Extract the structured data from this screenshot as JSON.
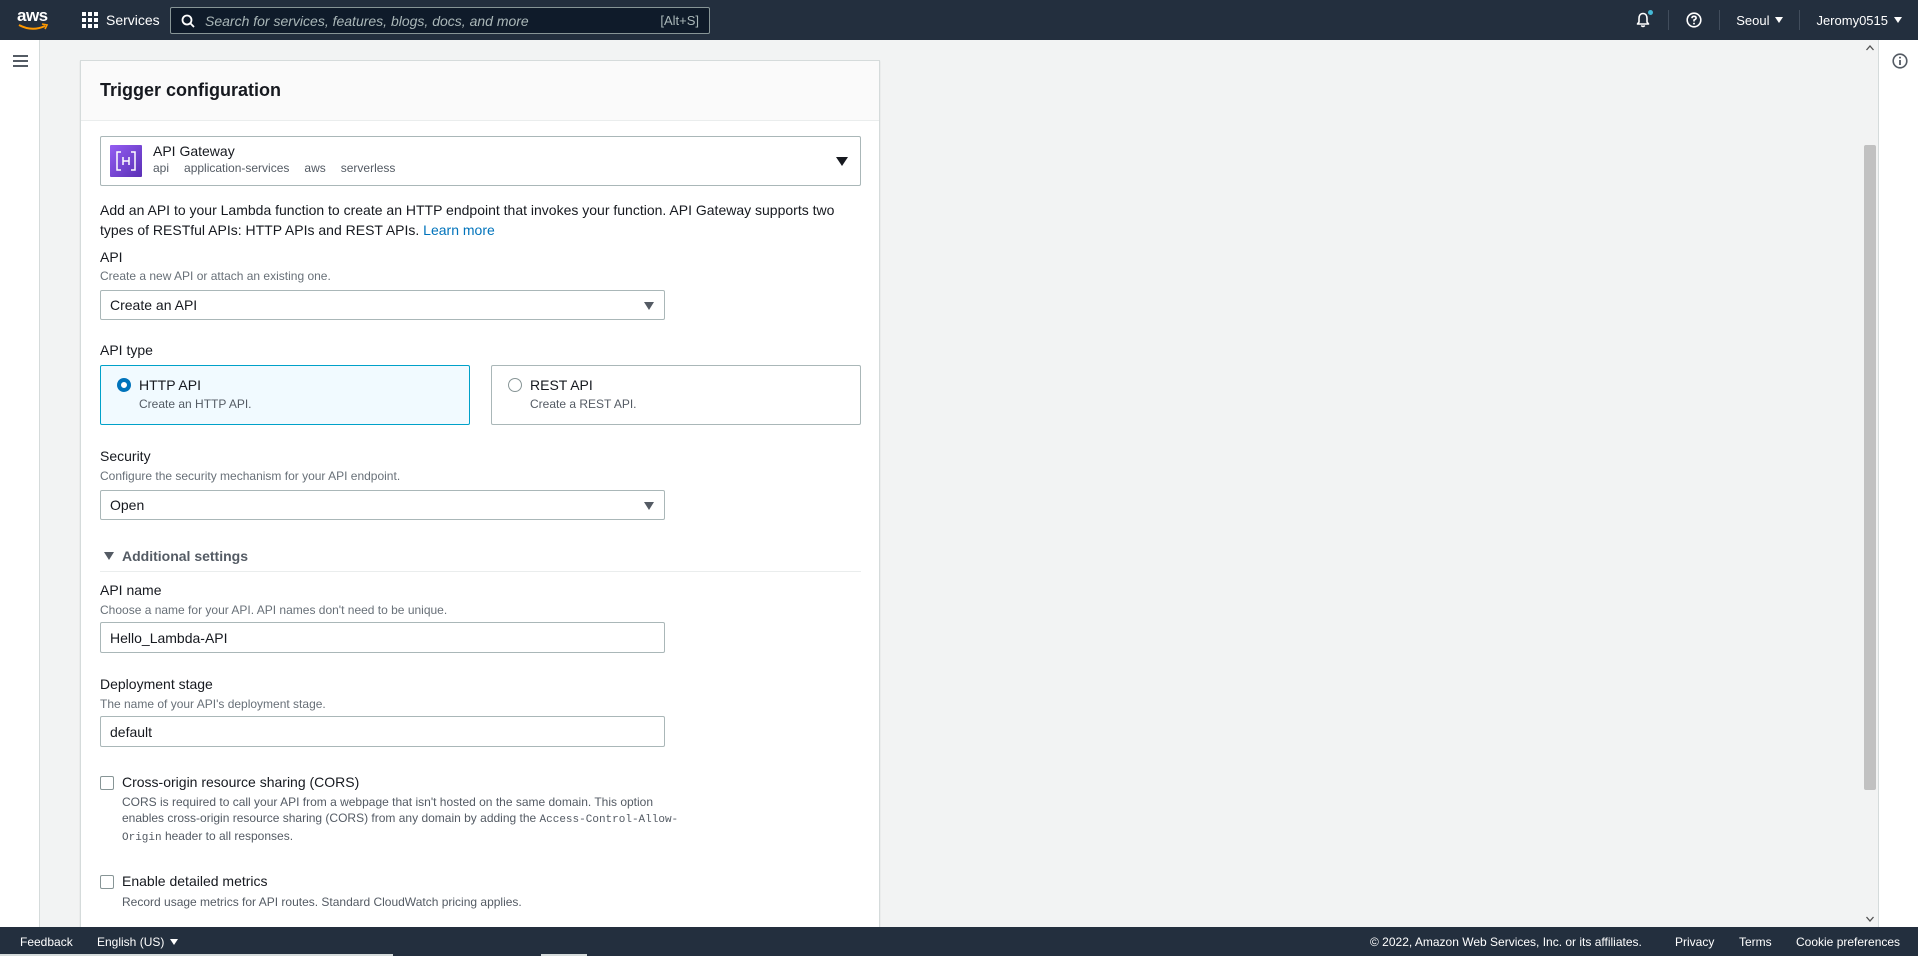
{
  "topnav": {
    "logo_text": "aws",
    "services_label": "Services",
    "search_placeholder": "Search for services, features, blogs, docs, and more",
    "search_shortcut": "[Alt+S]",
    "region": "Seoul",
    "user": "Jeromy0515",
    "notification_dot_color": "#44b9d6"
  },
  "icons": {
    "menu": "hamburger-icon",
    "info": "info-icon",
    "bell": "bell-icon",
    "help": "help-icon",
    "search": "search-icon",
    "grid": "grid-icon"
  },
  "panel": {
    "title": "Trigger configuration",
    "trigger": {
      "name": "API Gateway",
      "tags": [
        "api",
        "application-services",
        "aws",
        "serverless"
      ]
    },
    "description": "Add an API to your Lambda function to create an HTTP endpoint that invokes your function. API Gateway supports two types of RESTful APIs: HTTP APIs and REST APIs.",
    "learn_more": "Learn more",
    "api": {
      "label": "API",
      "sublabel": "Create a new API or attach an existing one.",
      "value": "Create an API"
    },
    "api_type": {
      "label": "API type",
      "options": [
        {
          "title": "HTTP API",
          "sub": "Create an HTTP API.",
          "selected": true
        },
        {
          "title": "REST API",
          "sub": "Create a REST API.",
          "selected": false
        }
      ]
    },
    "security": {
      "label": "Security",
      "sublabel": "Configure the security mechanism for your API endpoint.",
      "value": "Open"
    },
    "additional_settings": "Additional settings",
    "api_name": {
      "label": "API name",
      "sublabel": "Choose a name for your API. API names don't need to be unique.",
      "value": "Hello_Lambda-API"
    },
    "deployment_stage": {
      "label": "Deployment stage",
      "sublabel": "The name of your API's deployment stage.",
      "value": "default"
    },
    "cors": {
      "label": "Cross-origin resource sharing (CORS)",
      "desc_part1": "CORS is required to call your API from a webpage that isn't hosted on the same domain. This option enables cross-origin resource sharing (CORS) from any domain by adding the ",
      "desc_code": "Access-Control-Allow-Origin",
      "desc_part2": " header to all responses.",
      "checked": false
    },
    "metrics": {
      "label": "Enable detailed metrics",
      "desc": "Record usage metrics for API routes. Standard CloudWatch pricing applies.",
      "checked": false
    }
  },
  "footer": {
    "feedback": "Feedback",
    "language": "English (US)",
    "copyright": "© 2022, Amazon Web Services, Inc. or its affiliates.",
    "privacy": "Privacy",
    "terms": "Terms",
    "cookies": "Cookie preferences"
  },
  "colors": {
    "nav_bg": "#232f3e",
    "link": "#0073bb",
    "selected_border": "#00a1c9",
    "selected_bg": "#f1faff"
  }
}
